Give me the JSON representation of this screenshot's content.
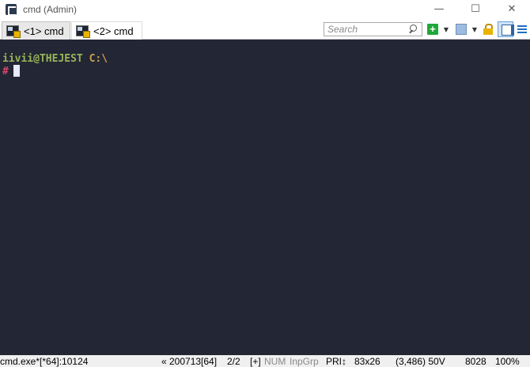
{
  "window": {
    "title": "cmd (Admin)",
    "controls": {
      "minimize": "—",
      "maximize": "☐",
      "close": "✕"
    }
  },
  "tabs": [
    {
      "label": "<1> cmd",
      "active": true
    },
    {
      "label": "<2> cmd",
      "active": false
    }
  ],
  "toolbar": {
    "search_placeholder": "Search",
    "new_console": "+",
    "dropdown": "▼"
  },
  "console": {
    "prompt_user_host": "iivii@THEJEST",
    "prompt_path": "C:\\",
    "prompt_symbol": "#",
    "background": "#232634"
  },
  "statusbar": {
    "process": "cmd.exe*[*64]:10124",
    "build": "« 200713[64]",
    "console_index": "2/2",
    "plus": "[+]",
    "num": "NUM",
    "inpgrp": "InpGrp",
    "pri": "PRI↕",
    "size": "83x26",
    "cursor_pos": "(3,486) 50V",
    "pid": "8028",
    "zoom": "100%"
  }
}
